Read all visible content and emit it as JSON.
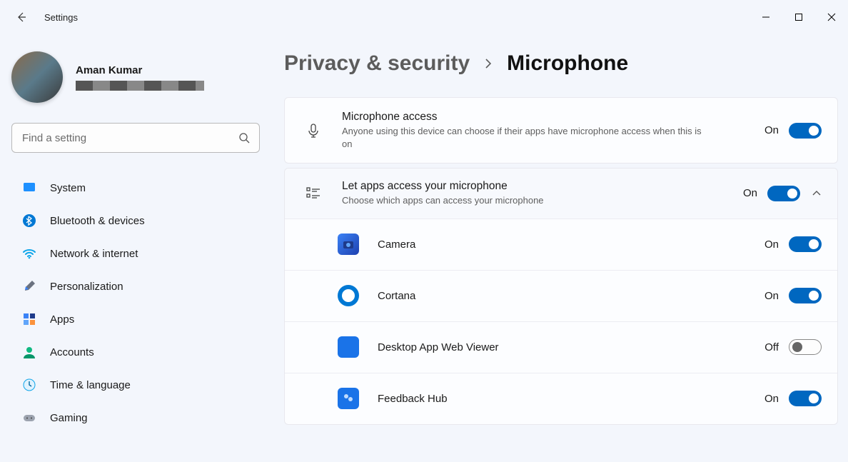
{
  "window": {
    "title": "Settings"
  },
  "user": {
    "name": "Aman Kumar"
  },
  "search": {
    "placeholder": "Find a setting"
  },
  "nav": {
    "items": [
      {
        "label": "System"
      },
      {
        "label": "Bluetooth & devices"
      },
      {
        "label": "Network & internet"
      },
      {
        "label": "Personalization"
      },
      {
        "label": "Apps"
      },
      {
        "label": "Accounts"
      },
      {
        "label": "Time & language"
      },
      {
        "label": "Gaming"
      }
    ]
  },
  "breadcrumb": {
    "parent": "Privacy & security",
    "current": "Microphone"
  },
  "mic_access": {
    "title": "Microphone access",
    "sub": "Anyone using this device can choose if their apps have microphone access when this is on",
    "state_label": "On"
  },
  "apps_access": {
    "title": "Let apps access your microphone",
    "sub": "Choose which apps can access your microphone",
    "state_label": "On"
  },
  "apps": [
    {
      "name": "Camera",
      "state_label": "On",
      "on": true
    },
    {
      "name": "Cortana",
      "state_label": "On",
      "on": true
    },
    {
      "name": "Desktop App Web Viewer",
      "state_label": "Off",
      "on": false
    },
    {
      "name": "Feedback Hub",
      "state_label": "On",
      "on": true
    }
  ]
}
